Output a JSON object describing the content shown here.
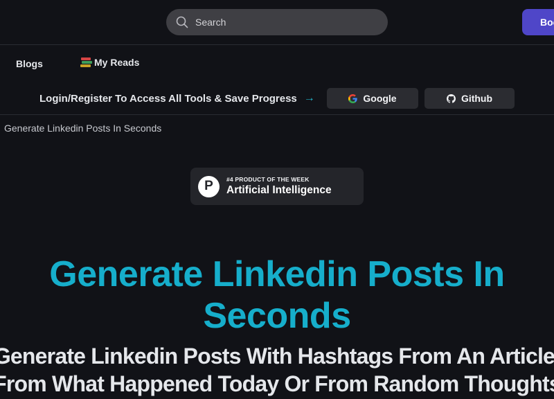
{
  "header": {
    "search_placeholder": "Search",
    "book_button_label": "Boo"
  },
  "nav": {
    "blogs_label": "Blogs",
    "my_reads_label": "My Reads",
    "my_reads_icon": "books-emoji"
  },
  "auth": {
    "prompt": "Login/Register To Access All Tools & Save Progress",
    "arrow": "→",
    "google_label": "Google",
    "github_label": "Github"
  },
  "breadcrumb": "Generate Linkedin Posts In Seconds",
  "badge": {
    "logo_letter": "P",
    "small": "#4 PRODUCT OF THE WEEK",
    "big": "Artificial Intelligence"
  },
  "hero": {
    "title_line1": "Generate Linkedin Posts In",
    "title_line2": "Seconds",
    "subtitle_line1": "Generate Linkedin Posts With Hashtags From An Article,",
    "subtitle_line2": "From What Happened Today Or From Random Thoughts"
  },
  "colors": {
    "background": "#111217",
    "accent": "#16aecb",
    "button_primary": "#4f46c8"
  }
}
